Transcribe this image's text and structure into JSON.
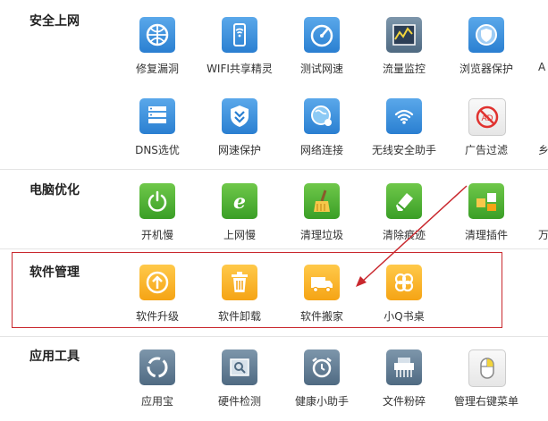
{
  "sections": [
    {
      "title": "安全上网",
      "rows": [
        [
          {
            "label": "修复漏洞",
            "icon": "shield-globe-icon"
          },
          {
            "label": "WIFI共享精灵",
            "icon": "wifi-share-icon"
          },
          {
            "label": "测试网速",
            "icon": "speedometer-icon"
          },
          {
            "label": "流量监控",
            "icon": "traffic-chart-icon"
          },
          {
            "label": "浏览器保护",
            "icon": "browser-shield-icon"
          },
          {
            "label": "A",
            "icon": ""
          }
        ],
        [
          {
            "label": "DNS选优",
            "icon": "dns-server-icon"
          },
          {
            "label": "网速保护",
            "icon": "speed-shield-icon"
          },
          {
            "label": "网络连接",
            "icon": "network-globe-icon"
          },
          {
            "label": "无线安全助手",
            "icon": "wifi-shield-icon"
          },
          {
            "label": "广告过滤",
            "icon": "ad-block-icon"
          },
          {
            "label": "乡",
            "icon": ""
          }
        ]
      ]
    },
    {
      "title": "电脑优化",
      "rows": [
        [
          {
            "label": "开机慢",
            "icon": "power-icon"
          },
          {
            "label": "上网慢",
            "icon": "ie-browser-icon"
          },
          {
            "label": "清理垃圾",
            "icon": "broom-icon"
          },
          {
            "label": "清除痕迹",
            "icon": "eraser-icon"
          },
          {
            "label": "清理插件",
            "icon": "puzzle-icon"
          },
          {
            "label": "万",
            "icon": ""
          }
        ]
      ]
    },
    {
      "title": "软件管理",
      "rows": [
        [
          {
            "label": "软件升级",
            "icon": "upgrade-arrow-icon"
          },
          {
            "label": "软件卸载",
            "icon": "trash-icon"
          },
          {
            "label": "软件搬家",
            "icon": "moving-truck-icon"
          },
          {
            "label": "小Q书桌",
            "icon": "clover-icon"
          }
        ]
      ]
    },
    {
      "title": "应用工具",
      "rows": [
        [
          {
            "label": "应用宝",
            "icon": "app-store-icon"
          },
          {
            "label": "硬件检测",
            "icon": "hardware-check-icon"
          },
          {
            "label": "健康小助手",
            "icon": "alarm-clock-icon"
          },
          {
            "label": "文件粉碎",
            "icon": "shredder-icon"
          },
          {
            "label": "管理右键菜单",
            "icon": "mouse-icon"
          }
        ]
      ]
    }
  ],
  "colors": {
    "highlight": "#c9282e",
    "arrow": "#c9282e"
  }
}
